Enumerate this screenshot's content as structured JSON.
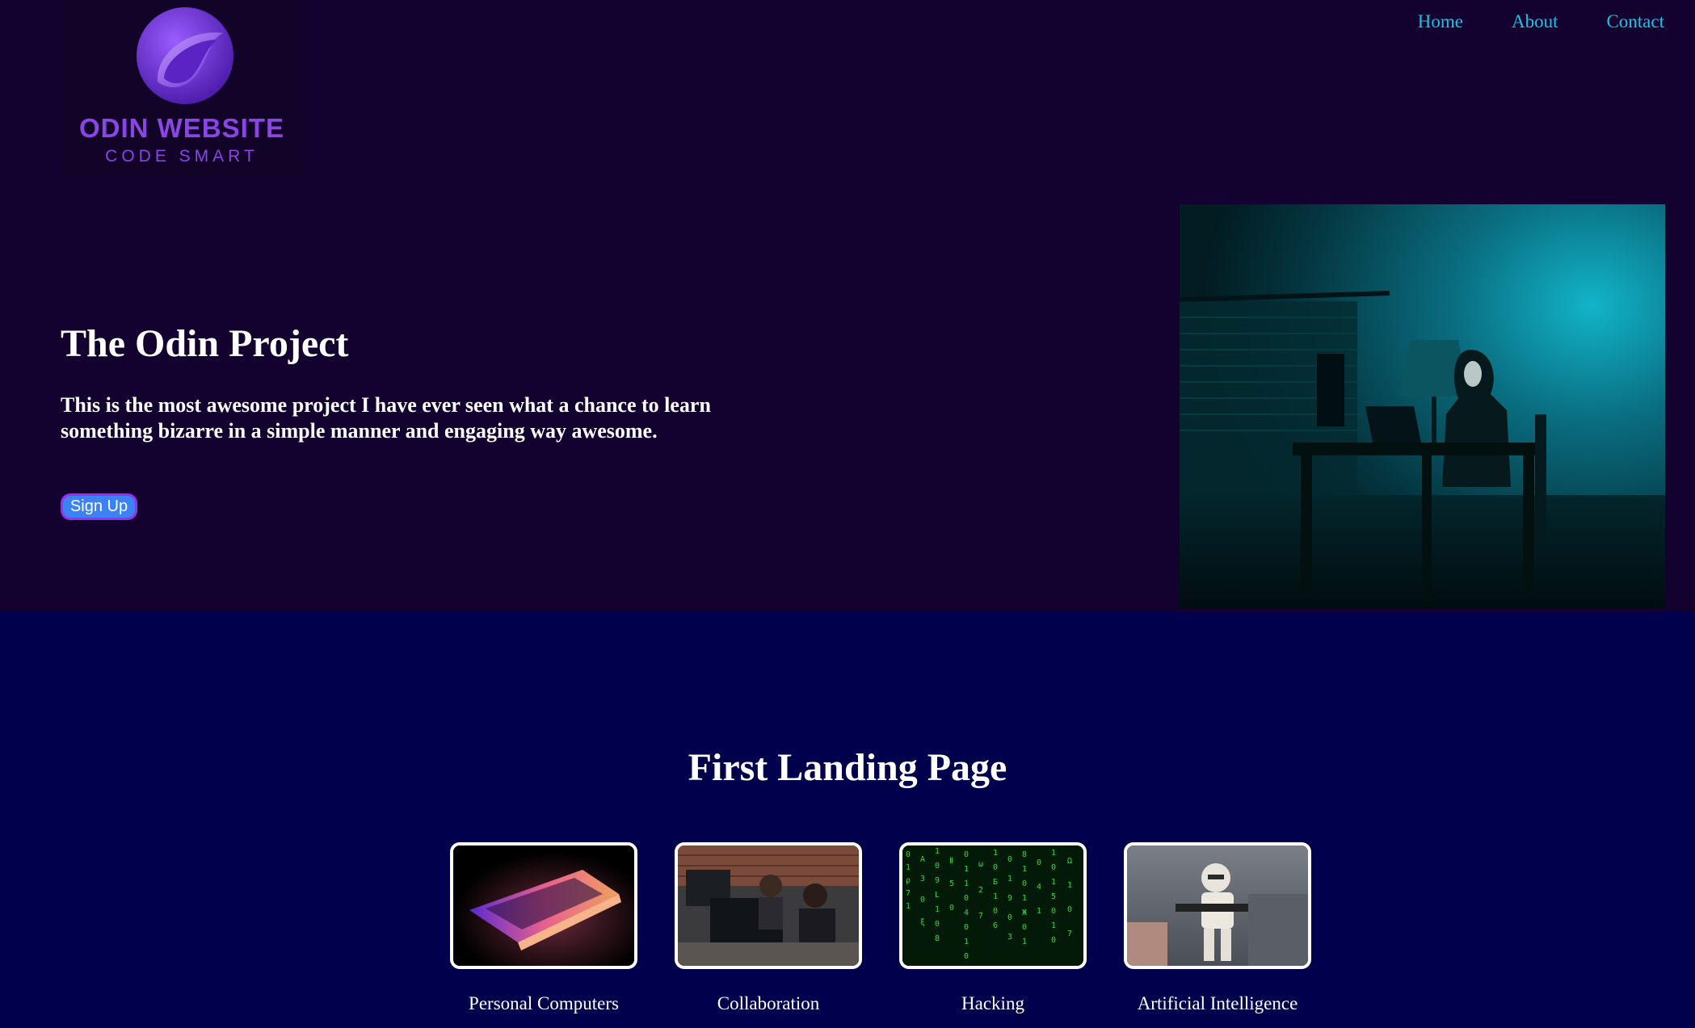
{
  "logo": {
    "title": "ODIN WEBSITE",
    "subtitle": "CODE SMART",
    "icon": "odin-swirl-logo"
  },
  "nav": {
    "items": [
      "Home",
      "About",
      "Contact"
    ]
  },
  "hero": {
    "title": "The Odin Project",
    "description": "This is the most awesome project I have ever seen what a chance to learn something bizarre in a simple manner and engaging way awesome.",
    "signup_label": "Sign Up",
    "image": "hooded-hacker-at-desk-photo"
  },
  "landing": {
    "title": "First Landing Page",
    "cards": [
      {
        "label": "Personal Computers",
        "image": "glowing-laptop-photo"
      },
      {
        "label": "Collaboration",
        "image": "office-coworkers-photo"
      },
      {
        "label": "Hacking",
        "image": "green-matrix-code-photo"
      },
      {
        "label": "Artificial Intelligence",
        "image": "robot-soldier-toy-photo"
      }
    ]
  },
  "colors": {
    "hero_bg": "#13022f",
    "landing_bg": "#01004c",
    "nav_link": "#19c3e3",
    "logo_purple": "#8b45e6",
    "button_bg": "#3b82f6",
    "button_border": "#9b2cf0"
  }
}
